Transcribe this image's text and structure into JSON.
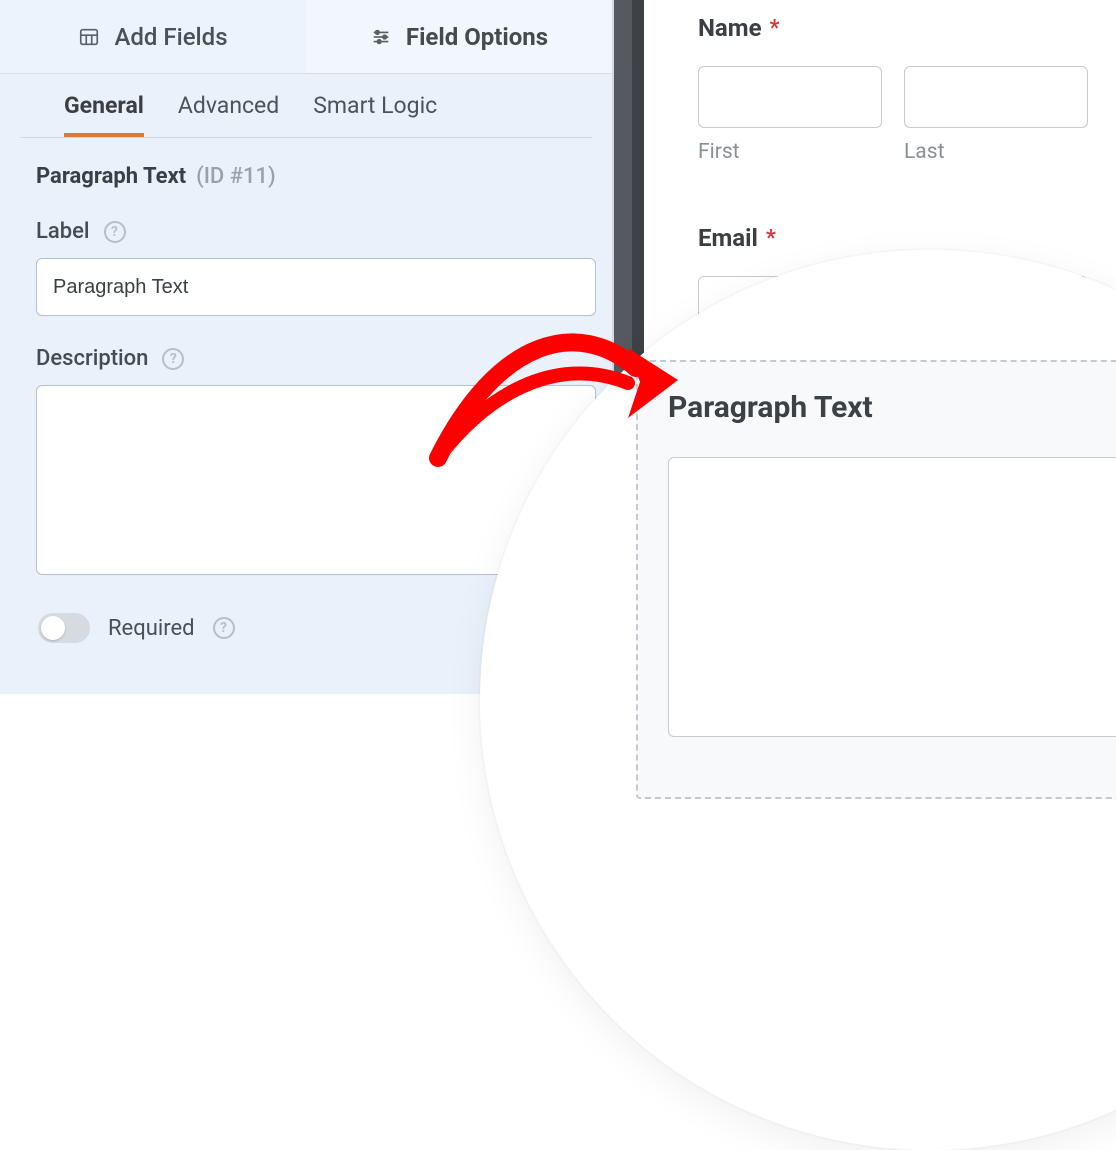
{
  "topTabs": {
    "addFields": "Add Fields",
    "fieldOptions": "Field Options"
  },
  "subTabs": {
    "general": "General",
    "advanced": "Advanced",
    "smartLogic": "Smart Logic"
  },
  "fieldHeader": {
    "type": "Paragraph Text",
    "id": "(ID #11)"
  },
  "labels": {
    "label": "Label",
    "description": "Description",
    "required": "Required"
  },
  "values": {
    "labelInput": "Paragraph Text",
    "descriptionInput": ""
  },
  "preview": {
    "nameLabel": "Name",
    "firstSub": "First",
    "lastSub": "Last",
    "emailLabel": "Email",
    "paragraphLabel": "Paragraph Text",
    "requiredMark": "*"
  }
}
